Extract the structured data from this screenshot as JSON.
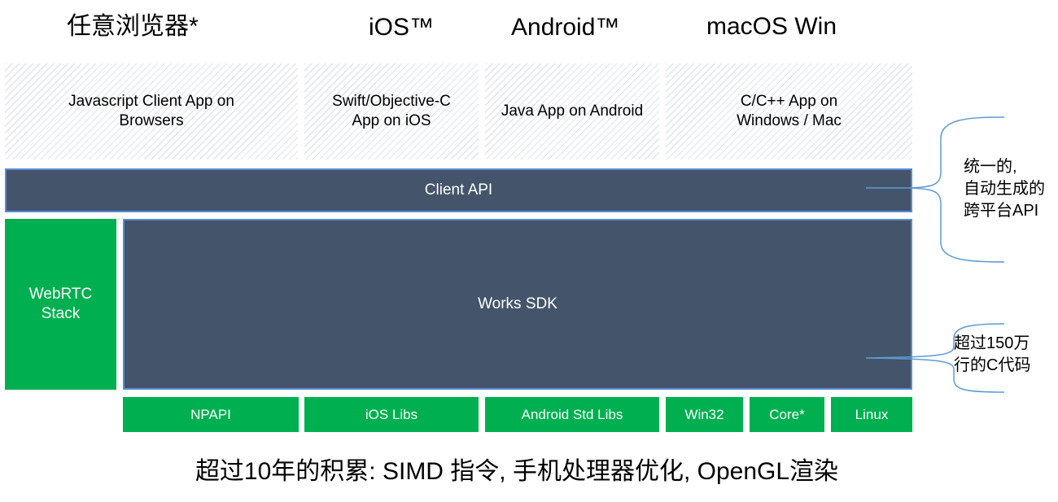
{
  "platforms": {
    "browsers": "任意浏览器*",
    "ios": "iOS™",
    "android": "Android™",
    "desktop": "macOS Win"
  },
  "apps": {
    "javascript": "Javascript Client App on\nBrowsers",
    "swift": "Swift/Objective-C\nApp on iOS",
    "java": "Java App on Android",
    "cpp": "C/C++ App on\nWindows / Mac"
  },
  "layers": {
    "client_api": "Client API",
    "works_sdk": "Works SDK",
    "webrtc": "WebRTC\nStack"
  },
  "libs": {
    "npapi": "NPAPI",
    "ios_libs": "iOS Libs",
    "android_libs": "Android Std Libs",
    "win32": "Win32",
    "core": "Core*",
    "linux": "Linux"
  },
  "notes": {
    "api_line1": "统一的,",
    "api_line2": "自动生成的",
    "api_line3": "跨平台API",
    "code_line1": "超过150万",
    "code_line2": "行的C代码"
  },
  "footer": "超过10年的积累: SIMD 指令, 手机处理器优化, OpenGL渲染",
  "colors": {
    "sdk_fill": "#44546a",
    "sdk_border": "#5b8bd6",
    "green": "#00b050",
    "brace": "#5b9bd5"
  }
}
